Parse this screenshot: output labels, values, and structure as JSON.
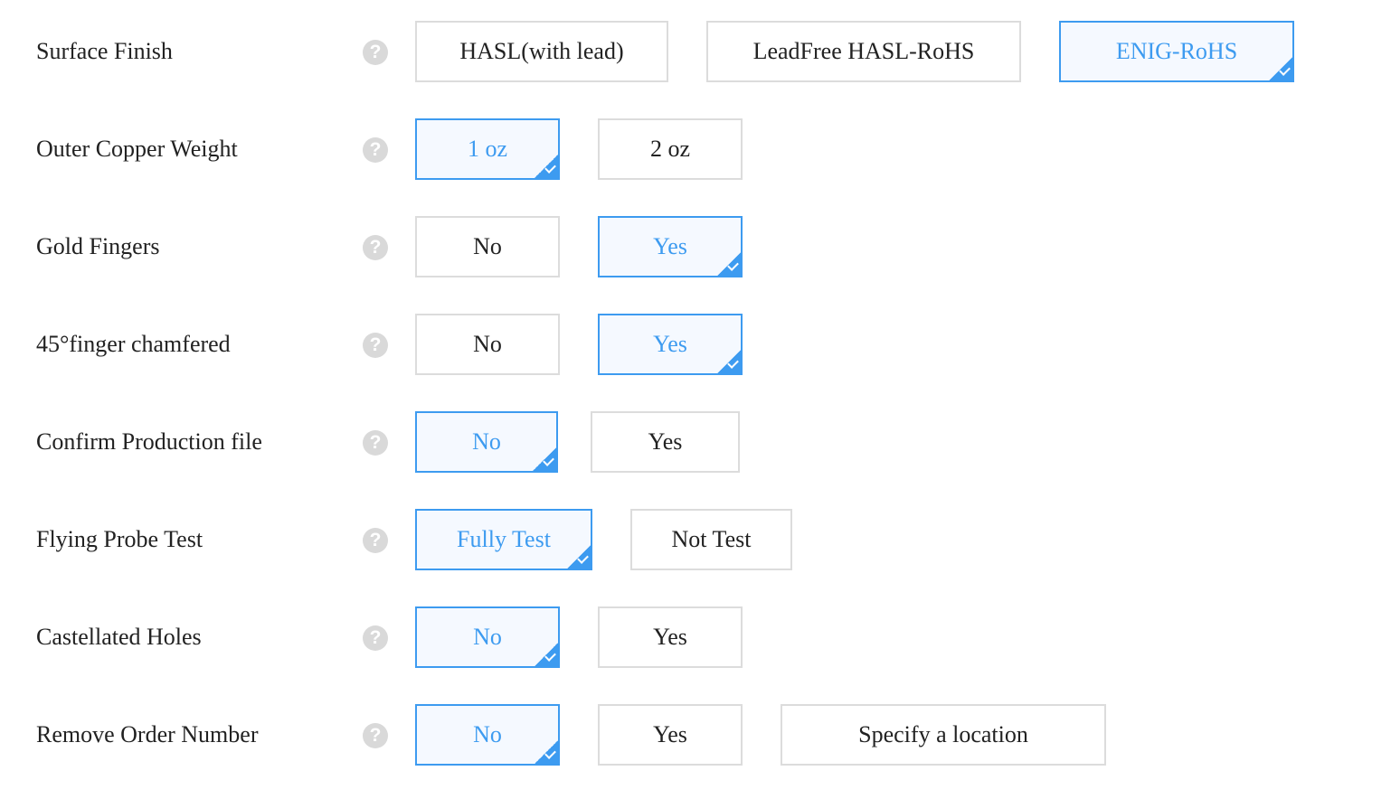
{
  "help_glyph": "?",
  "colors": {
    "accent": "#3d9bf0",
    "selected_bg": "#f5f9ff",
    "border": "#dcdcdc",
    "help_bg": "#d9d9d9"
  },
  "rows": [
    {
      "label": "Surface Finish",
      "options": [
        "HASL(with lead)",
        "LeadFree HASL-RoHS",
        "ENIG-RoHS"
      ],
      "selected": "ENIG-RoHS"
    },
    {
      "label": "Outer Copper Weight",
      "options": [
        "1 oz",
        "2 oz"
      ],
      "selected": "1 oz"
    },
    {
      "label": "Gold Fingers",
      "options": [
        "No",
        "Yes"
      ],
      "selected": "Yes"
    },
    {
      "label": "45°finger chamfered",
      "options": [
        "No",
        "Yes"
      ],
      "selected": "Yes"
    },
    {
      "label": "Confirm Production file",
      "options": [
        "No",
        "Yes"
      ],
      "selected": "No"
    },
    {
      "label": "Flying Probe Test",
      "options": [
        "Fully Test",
        "Not Test"
      ],
      "selected": "Fully Test"
    },
    {
      "label": "Castellated Holes",
      "options": [
        "No",
        "Yes"
      ],
      "selected": "No"
    },
    {
      "label": "Remove Order Number",
      "options": [
        "No",
        "Yes",
        "Specify a location"
      ],
      "selected": "No"
    }
  ]
}
